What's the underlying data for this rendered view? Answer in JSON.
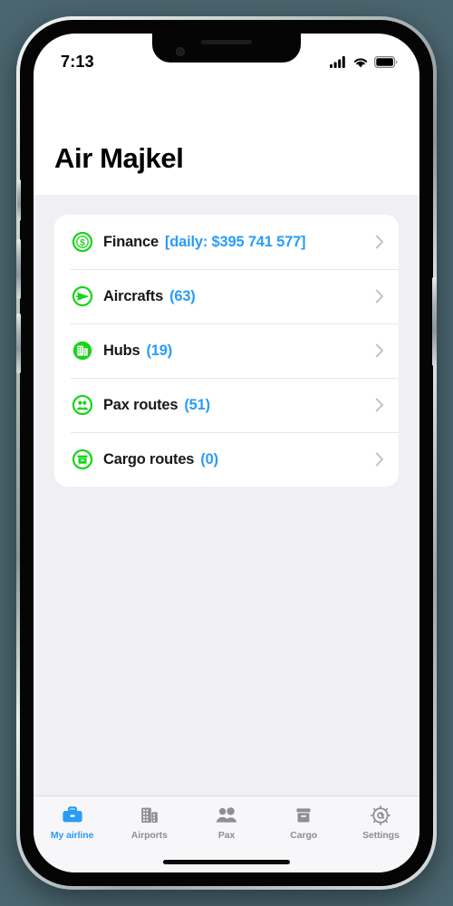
{
  "status_bar": {
    "time": "7:13",
    "signal_icon": "cellular-signal-icon",
    "wifi_icon": "wifi-icon",
    "battery_icon": "battery-full-icon"
  },
  "header": {
    "title": "Air Majkel"
  },
  "colors": {
    "accent_blue": "#2a9cf8",
    "icon_green": "#17d41a",
    "page_background": "#f0f0f4",
    "card_background": "#ffffff",
    "tab_inactive": "#8e8e93",
    "outside_background": "#4b6670"
  },
  "main": {
    "rows": [
      {
        "icon": "dollar-coin-icon",
        "label": "Finance",
        "value": "[daily: $395 741 577]",
        "chevron": "chevron-right-icon"
      },
      {
        "icon": "airplane-circle-icon",
        "label": "Aircrafts",
        "value": "(63)",
        "chevron": "chevron-right-icon"
      },
      {
        "icon": "buildings-circle-icon",
        "label": "Hubs",
        "value": "(19)",
        "chevron": "chevron-right-icon"
      },
      {
        "icon": "people-circle-icon",
        "label": "Pax routes",
        "value": "(51)",
        "chevron": "chevron-right-icon"
      },
      {
        "icon": "box-circle-icon",
        "label": "Cargo routes",
        "value": "(0)",
        "chevron": "chevron-right-icon"
      }
    ]
  },
  "tab_bar": {
    "active_index": 0,
    "tabs": [
      {
        "label": "My airline",
        "icon": "briefcase-icon"
      },
      {
        "label": "Airports",
        "icon": "buildings-icon"
      },
      {
        "label": "Pax",
        "icon": "people-icon"
      },
      {
        "label": "Cargo",
        "icon": "box-icon"
      },
      {
        "label": "Settings",
        "icon": "gear-icon"
      }
    ]
  }
}
